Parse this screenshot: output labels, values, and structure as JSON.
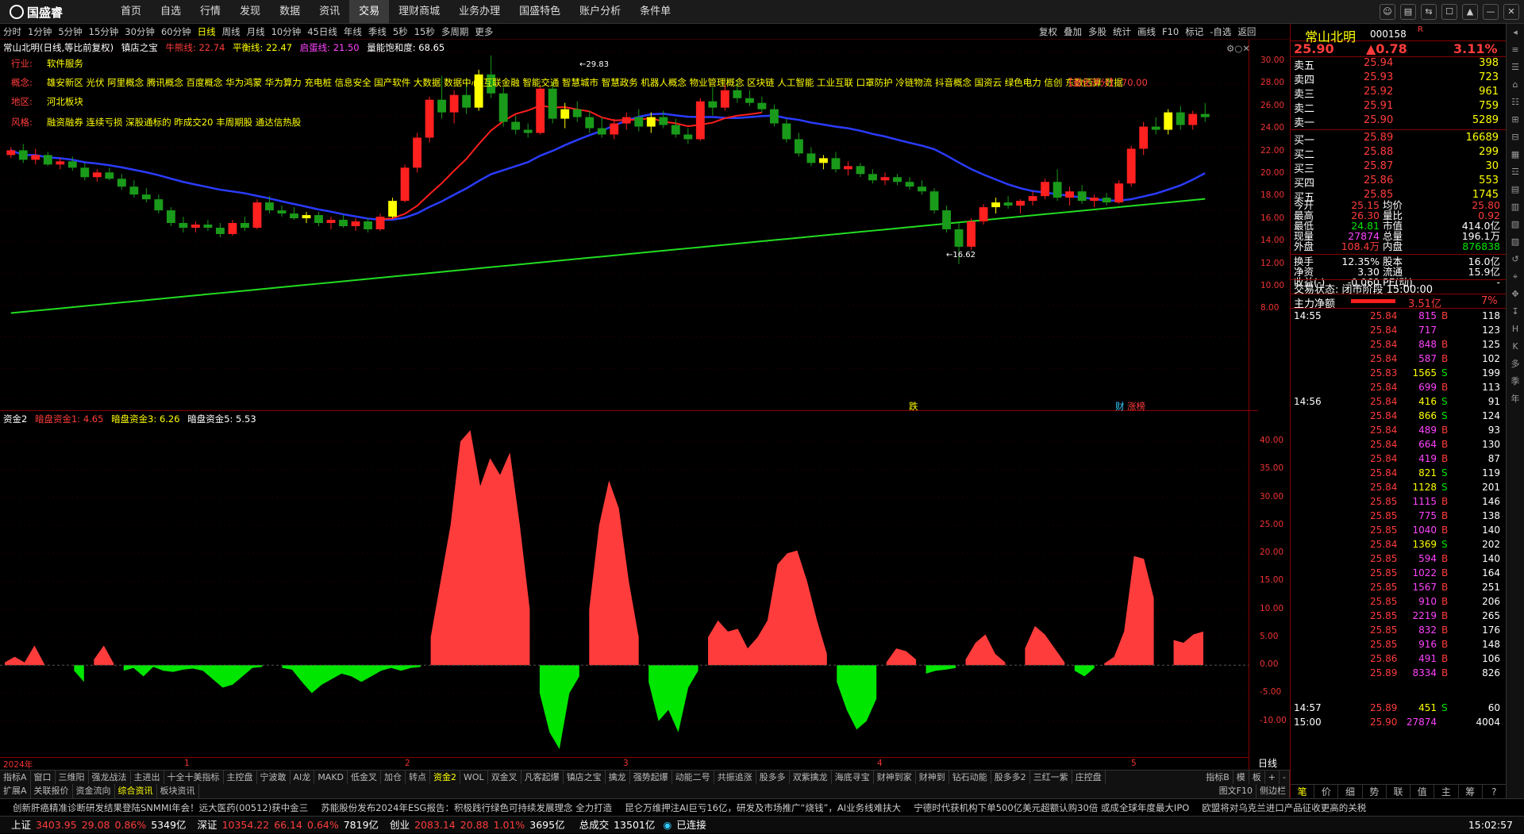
{
  "app": {
    "logo": "国盛睿"
  },
  "menu": [
    "首页",
    "自选",
    "行情",
    "发现",
    "数据",
    "资讯",
    "交易",
    "理财商城",
    "业务办理",
    "国盛特色",
    "账户分析",
    "条件单"
  ],
  "menu_active": "交易",
  "window_buttons": [
    "☺",
    "▤",
    "⇆",
    "☐",
    "▲",
    "—",
    "✕"
  ],
  "timeframes": [
    "分时",
    "1分钟",
    "5分钟",
    "15分钟",
    "30分钟",
    "60分钟",
    "日线",
    "周线",
    "月线",
    "10分钟",
    "45日线",
    "年线",
    "季线",
    "5秒",
    "15秒",
    "多周期",
    "更多"
  ],
  "timeframe_active": "日线",
  "tools": [
    "复权",
    "叠加",
    "多股",
    "统计",
    "画线",
    "F10",
    "标记",
    "-自选",
    "返回"
  ],
  "kline": {
    "title": "常山北明(日线,等比前复权)",
    "indicator": "镇店之宝",
    "ma1": "牛熊线: 22.74",
    "ma2": "平衡线: 22.47",
    "ma3": "启蛋线: 21.50",
    "sat": "量能饱和度: 68.65",
    "industry_label": "行业:",
    "industry": "软件服务",
    "concept_label": "概念:",
    "concept": "雄安新区 光伏 阿里概念 腾讯概念 百度概念 华为鸿蒙 华为算力 充电桩 信息安全 国产软件 大数据 数据中心 互联金融 智能交通 智慧城市 智慧政务 机器人概念 物业管理概念 区块链 人工智能 工业互联 口罩防护 冷链物流 抖音概念 国资云 绿色电力 信创 东数西算 数据",
    "region_label": "地区:",
    "region": "河北板块",
    "style_label": "风格:",
    "style": "融资融券 连续亏损 深股通标的 昨成交20 丰周期股 通达信热股",
    "rating": "【量化评分】:70.00",
    "high_mark": "29.83",
    "low_mark": "16.62",
    "bottom_tags": [
      "跌",
      "财",
      "涨榜"
    ]
  },
  "yaxis": [
    "30.00",
    "28.00",
    "26.00",
    "24.00",
    "22.00",
    "20.00",
    "18.00",
    "16.00",
    "14.00",
    "12.00",
    "10.00",
    "8.00"
  ],
  "sub": {
    "title": "资金2",
    "s1": "暗盘资金1: 4.65",
    "s3": "暗盘资金3: 6.26",
    "s5": "暗盘资金5: 5.53"
  },
  "sub_axis": [
    "40.00",
    "35.00",
    "30.00",
    "25.00",
    "20.00",
    "15.00",
    "10.00",
    "5.00",
    "0.00",
    "-5.00",
    "-10.00"
  ],
  "x_labels": [
    "2024年",
    "1",
    "2",
    "3",
    "4",
    "5"
  ],
  "period_label": "日线",
  "chart_data": {
    "type": "area",
    "title": "资金2",
    "series": [
      {
        "name": "暗盘资金",
        "values": [
          0.5,
          1.5,
          0.5,
          3.5,
          0.2,
          -2.0,
          1.5,
          -1.0,
          -3.0,
          1.0,
          3.5,
          0.3,
          -1.0,
          -0.5,
          -2.0,
          -0.3,
          -1.0,
          -1.2,
          -0.8,
          -0.6,
          -1.0,
          -2.5,
          -4.0,
          -3.5,
          -2.0,
          -0.5,
          -0.3,
          0.3,
          -0.5,
          -0.8,
          -3.0,
          -5.0,
          -3.5,
          -2.5,
          -1.5,
          -2.0,
          -3.0,
          -2.0,
          -1.0,
          -0.5,
          -1.0,
          -0.5,
          -0.3,
          5.0,
          15.0,
          25.0,
          40.0,
          42.0,
          32.0,
          37.0,
          34.0,
          38.0,
          25.0,
          10.0,
          -5.0,
          -12.0,
          -15.0,
          -5.0,
          -2.0,
          10.0,
          25.0,
          33.0,
          28.0,
          15.0,
          5.0,
          -3.0,
          -10.0,
          -8.0,
          -12.0,
          -4.0,
          -1.0,
          5.0,
          8.0,
          6.0,
          6.5,
          3.0,
          5.0,
          8.0,
          18.0,
          20.0,
          20.5,
          15.0,
          8.0,
          2.0,
          -3.0,
          -8.0,
          -11.5,
          -10.0,
          -6.0,
          0.5,
          3.0,
          2.5,
          1.0,
          -1.5,
          -1.0,
          -0.8,
          -0.5,
          1.0,
          4.0,
          5.5,
          2.0,
          0.5,
          -0.3,
          3.0,
          7.0,
          5.5,
          3.0,
          0.5,
          -1.0,
          -2.0,
          -0.5,
          0.3,
          1.5,
          6.0,
          19.5,
          19.0,
          12.0,
          -0.5,
          4.5,
          4.0,
          5.5,
          6.0
        ]
      }
    ],
    "ylim": [
      -15,
      44
    ]
  },
  "price_ohlc": [
    [
      23.5,
      24.0,
      23.3,
      23.8
    ],
    [
      23.8,
      24.2,
      23.0,
      23.2
    ],
    [
      23.2,
      23.9,
      22.9,
      23.5
    ],
    [
      23.5,
      23.7,
      22.8,
      22.9
    ],
    [
      22.9,
      23.3,
      22.6,
      23.1
    ],
    [
      23.1,
      23.4,
      22.5,
      22.7
    ],
    [
      22.7,
      23.0,
      21.9,
      22.1
    ],
    [
      22.1,
      22.6,
      21.8,
      22.4
    ],
    [
      22.4,
      22.7,
      21.9,
      22.0
    ],
    [
      22.0,
      22.3,
      21.3,
      21.5
    ],
    [
      21.5,
      21.9,
      20.8,
      21.0
    ],
    [
      21.0,
      21.4,
      20.5,
      20.7
    ],
    [
      20.7,
      21.0,
      19.8,
      20.0
    ],
    [
      20.0,
      20.2,
      19.0,
      19.2
    ],
    [
      19.2,
      19.6,
      18.6,
      18.9
    ],
    [
      18.9,
      19.3,
      18.6,
      19.1
    ],
    [
      19.1,
      19.4,
      18.7,
      18.9
    ],
    [
      18.9,
      19.2,
      18.3,
      18.5
    ],
    [
      18.5,
      19.4,
      18.4,
      19.2
    ],
    [
      19.2,
      19.6,
      18.7,
      18.9
    ],
    [
      18.9,
      20.7,
      18.8,
      20.5
    ],
    [
      20.5,
      20.9,
      19.8,
      20.0
    ],
    [
      20.0,
      20.3,
      19.6,
      19.8
    ],
    [
      19.8,
      20.2,
      19.4,
      19.5
    ],
    [
      19.5,
      19.9,
      19.2,
      19.7
    ],
    [
      19.7,
      19.9,
      19.0,
      19.2
    ],
    [
      19.2,
      19.6,
      18.8,
      19.4
    ],
    [
      19.4,
      19.7,
      18.9,
      19.0
    ],
    [
      19.0,
      19.5,
      18.7,
      19.3
    ],
    [
      19.3,
      19.5,
      18.6,
      18.8
    ],
    [
      18.8,
      19.8,
      18.7,
      19.6
    ],
    [
      19.6,
      20.8,
      19.5,
      20.6
    ],
    [
      20.6,
      22.9,
      20.5,
      22.7
    ],
    [
      22.7,
      24.9,
      22.4,
      24.6
    ],
    [
      24.6,
      27.2,
      24.3,
      27.0
    ],
    [
      27.0,
      28.5,
      25.8,
      26.2
    ],
    [
      26.2,
      27.6,
      25.5,
      27.3
    ],
    [
      27.3,
      28.3,
      26.1,
      26.5
    ],
    [
      26.5,
      28.9,
      26.3,
      28.6
    ],
    [
      28.6,
      29.8,
      27.1,
      27.4
    ],
    [
      27.4,
      27.8,
      25.3,
      25.6
    ],
    [
      25.6,
      26.0,
      24.8,
      25.1
    ],
    [
      25.1,
      25.5,
      24.6,
      24.9
    ],
    [
      24.9,
      27.9,
      24.8,
      27.7
    ],
    [
      27.7,
      28.1,
      25.5,
      25.8
    ],
    [
      25.8,
      26.8,
      25.2,
      26.4
    ],
    [
      26.4,
      26.9,
      25.6,
      25.9
    ],
    [
      25.9,
      26.3,
      24.9,
      25.2
    ],
    [
      25.2,
      25.9,
      24.6,
      24.8
    ],
    [
      24.8,
      25.8,
      24.5,
      25.5
    ],
    [
      25.5,
      26.2,
      25.1,
      25.9
    ],
    [
      25.9,
      26.4,
      25.0,
      25.3
    ],
    [
      25.3,
      26.2,
      24.9,
      25.9
    ],
    [
      25.9,
      26.3,
      25.2,
      25.4
    ],
    [
      25.4,
      25.8,
      24.6,
      24.8
    ],
    [
      24.8,
      25.2,
      24.2,
      24.5
    ],
    [
      24.5,
      27.1,
      24.4,
      26.9
    ],
    [
      26.9,
      27.8,
      26.0,
      26.5
    ],
    [
      26.5,
      28.0,
      26.3,
      27.6
    ],
    [
      27.6,
      28.2,
      26.8,
      27.1
    ],
    [
      27.1,
      27.6,
      26.6,
      26.8
    ],
    [
      26.8,
      27.2,
      26.2,
      26.4
    ],
    [
      26.4,
      26.7,
      25.3,
      25.5
    ],
    [
      25.5,
      25.8,
      24.3,
      24.5
    ],
    [
      24.5,
      24.9,
      23.4,
      23.6
    ],
    [
      23.6,
      24.0,
      22.8,
      23.0
    ],
    [
      23.0,
      23.5,
      22.6,
      23.3
    ],
    [
      23.3,
      23.7,
      22.4,
      22.6
    ],
    [
      22.6,
      23.1,
      22.2,
      22.8
    ],
    [
      22.8,
      23.0,
      22.1,
      22.3
    ],
    [
      22.3,
      22.6,
      21.7,
      21.9
    ],
    [
      21.9,
      22.4,
      21.6,
      22.1
    ],
    [
      22.1,
      22.3,
      21.6,
      21.8
    ],
    [
      21.8,
      22.1,
      21.3,
      21.5
    ],
    [
      21.5,
      21.9,
      21.0,
      21.2
    ],
    [
      21.2,
      21.4,
      19.8,
      20.0
    ],
    [
      20.0,
      20.3,
      18.6,
      18.8
    ],
    [
      18.8,
      19.2,
      16.6,
      17.7
    ],
    [
      17.7,
      19.5,
      17.5,
      19.3
    ],
    [
      19.3,
      20.4,
      19.1,
      20.2
    ],
    [
      20.2,
      20.8,
      19.8,
      20.5
    ],
    [
      20.5,
      20.9,
      20.1,
      20.3
    ],
    [
      20.3,
      20.7,
      19.8,
      20.6
    ],
    [
      20.6,
      21.2,
      20.3,
      20.9
    ],
    [
      20.9,
      22.0,
      20.7,
      21.8
    ],
    [
      21.8,
      22.6,
      20.6,
      20.8
    ],
    [
      20.8,
      21.5,
      20.3,
      21.2
    ],
    [
      21.2,
      21.6,
      20.4,
      20.6
    ],
    [
      20.6,
      21.0,
      20.2,
      20.8
    ],
    [
      20.8,
      21.1,
      20.3,
      20.5
    ],
    [
      20.5,
      21.9,
      20.4,
      21.7
    ],
    [
      21.7,
      24.1,
      21.5,
      23.9
    ],
    [
      23.9,
      25.6,
      23.5,
      25.3
    ],
    [
      25.3,
      25.9,
      24.8,
      25.1
    ],
    [
      25.1,
      26.4,
      24.8,
      26.2
    ],
    [
      26.2,
      26.6,
      25.1,
      25.4
    ],
    [
      25.4,
      26.3,
      25.1,
      26.1
    ],
    [
      26.1,
      26.8,
      25.6,
      25.9
    ]
  ],
  "quote": {
    "name": "常山北明",
    "code": "000158",
    "r": "R",
    "price": "25.90",
    "change": "▲0.78",
    "pct": "3.11%",
    "asks": [
      [
        "卖五",
        "25.94",
        "398"
      ],
      [
        "卖四",
        "25.93",
        "723"
      ],
      [
        "卖三",
        "25.92",
        "961"
      ],
      [
        "卖二",
        "25.91",
        "759"
      ],
      [
        "卖一",
        "25.90",
        "5289"
      ]
    ],
    "bids": [
      [
        "买一",
        "25.89",
        "16689"
      ],
      [
        "买二",
        "25.88",
        "299"
      ],
      [
        "买三",
        "25.87",
        "30"
      ],
      [
        "买四",
        "25.86",
        "553"
      ],
      [
        "买五",
        "25.85",
        "1745"
      ]
    ],
    "stats": [
      [
        "今开",
        "25.15",
        "均价",
        "25.80"
      ],
      [
        "最高",
        "26.30",
        "量比",
        "0.92"
      ],
      [
        "最低",
        "24.81",
        "市值",
        "414.0亿"
      ],
      [
        "现量",
        "27874",
        "总量",
        "196.1万"
      ],
      [
        "外盘",
        "108.4万",
        "内盘",
        "876838"
      ],
      [
        "换手",
        "12.35%",
        "股本",
        "16.0亿"
      ],
      [
        "净资",
        "3.30",
        "流通",
        "15.9亿"
      ],
      [
        "收益(-)",
        "-0.060",
        "PE(动)",
        "-"
      ]
    ],
    "trade_state": "交易状态: 闭市阶段 15:00:00",
    "zljl_label": "主力净额",
    "zljl": "3.51亿",
    "zljl_pct": "7%",
    "ticks": [
      [
        "14:55",
        "25.84",
        "815",
        "B",
        "118"
      ],
      [
        "",
        "25.84",
        "717",
        "",
        "123"
      ],
      [
        "",
        "25.84",
        "848",
        "B",
        "125"
      ],
      [
        "",
        "25.84",
        "587",
        "B",
        "102"
      ],
      [
        "",
        "25.83",
        "1565",
        "S",
        "199"
      ],
      [
        "",
        "25.84",
        "699",
        "B",
        "113"
      ],
      [
        "14:56",
        "25.84",
        "416",
        "S",
        "91"
      ],
      [
        "",
        "25.84",
        "866",
        "S",
        "124"
      ],
      [
        "",
        "25.84",
        "489",
        "B",
        "93"
      ],
      [
        "",
        "25.84",
        "664",
        "B",
        "130"
      ],
      [
        "",
        "25.84",
        "419",
        "B",
        "87"
      ],
      [
        "",
        "25.84",
        "821",
        "S",
        "119"
      ],
      [
        "",
        "25.84",
        "1128",
        "S",
        "201"
      ],
      [
        "",
        "25.85",
        "1115",
        "B",
        "146"
      ],
      [
        "",
        "25.85",
        "775",
        "B",
        "138"
      ],
      [
        "",
        "25.85",
        "1040",
        "B",
        "140"
      ],
      [
        "",
        "25.84",
        "1369",
        "S",
        "202"
      ],
      [
        "",
        "25.85",
        "594",
        "B",
        "140"
      ],
      [
        "",
        "25.85",
        "1022",
        "B",
        "164"
      ],
      [
        "",
        "25.85",
        "1567",
        "B",
        "251"
      ],
      [
        "",
        "25.85",
        "910",
        "B",
        "206"
      ],
      [
        "",
        "25.85",
        "2219",
        "B",
        "265"
      ],
      [
        "",
        "25.85",
        "832",
        "B",
        "176"
      ],
      [
        "",
        "25.85",
        "916",
        "B",
        "148"
      ],
      [
        "",
        "25.86",
        "491",
        "B",
        "106"
      ],
      [
        "",
        "25.89",
        "8334",
        "B",
        "826"
      ],
      [
        "14:57",
        "25.89",
        "451",
        "S",
        "60"
      ],
      [
        "15:00",
        "25.90",
        "27874",
        "",
        "4004"
      ]
    ]
  },
  "side_tabs": [
    "笔",
    "价",
    "细",
    "势",
    "联",
    "值",
    "主",
    "筹",
    "?"
  ],
  "right_toolbar": [
    "◂",
    "≡",
    "☰",
    "⌂",
    "☷",
    "⊞",
    "⊟",
    "▦",
    "☲",
    "▤",
    "▥",
    "▧",
    "▨",
    "↺",
    "⌖",
    "✥",
    "↧",
    "H",
    "K",
    "多",
    "季",
    "年"
  ],
  "indicator_tabs": [
    "指标A",
    "窗口",
    "三维阳",
    "强龙战法",
    "主进出",
    "十全十美指标",
    "主控盘",
    "宁波敢",
    "AI龙",
    "MAKD",
    "低金叉",
    "加仓",
    "转点",
    "资金2",
    "WOL",
    "双金叉",
    "凡客起爆",
    "镇店之宝",
    "擒龙",
    "强势起爆",
    "动能二号",
    "共振追涨",
    "股多多",
    "双紫擒龙",
    "海底寻宝",
    "财神到家",
    "财神到",
    "钻石动能",
    "股多多2",
    "三红一紫",
    "庄控盘"
  ],
  "indicator_active": "资金2",
  "indicator_right": [
    "指标B",
    "模",
    "板",
    "+",
    "-"
  ],
  "news_tabs": [
    "扩展A",
    "关联报价",
    "资金流向",
    "综合资讯",
    "板块资讯"
  ],
  "news_tab_active": "综合资讯",
  "news": [
    "创新肝癌精准诊断研发结果登陆SNMMI年会！远大医药(00512)获中金三",
    "苏能股份发布2024年ESG报告：积极践行绿色可持续发展理念 全力打造",
    "昆仑万维押注AI巨亏16亿，研发及市场推广“烧钱”，AI业务线难扶大",
    "宁德时代获机构下单500亿美元超额认购30倍 或成全球年度最大IPO",
    "欧盟将对乌克兰进口产品征收更高的关税"
  ],
  "news_right": [
    "图文F10",
    "侧边栏"
  ],
  "status": {
    "idx": [
      [
        "上证",
        "3403.95",
        "29.08",
        "0.86%",
        "5349亿"
      ],
      [
        "深证",
        "10354.22",
        "66.14",
        "0.64%",
        "7819亿"
      ],
      [
        "创业",
        "2083.14",
        "20.88",
        "1.01%",
        "3695亿"
      ]
    ],
    "total_label": "总成交",
    "total": "13501亿",
    "conn": "已连接",
    "time": "15:02:57"
  },
  "colors": {
    "up": "#ff3c3c",
    "down": "#00e600",
    "ma_blue": "#2a3cff",
    "ma_red": "#ff1e1e",
    "ma_green": "#22dd22"
  }
}
